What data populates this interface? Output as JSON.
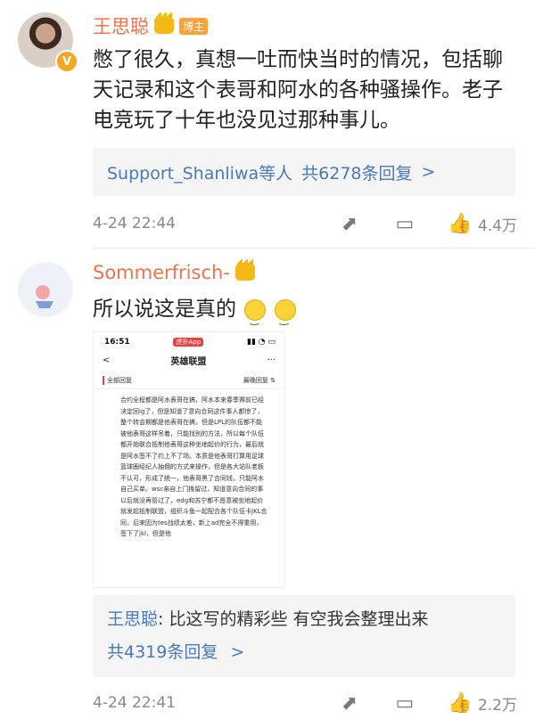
{
  "comments": [
    {
      "user": "王思聪",
      "badge": "博主",
      "verified": "V",
      "text": "憋了很久，真想一吐而快当时的情况，包括聊天记录和这个表哥和阿水的各种骚操作。老子电竞玩了十年也没见过那种事儿。",
      "replies_summary": {
        "users": "Support_Shanliwa等人",
        "count": "共6278条回复",
        "chevron": ">"
      },
      "time": "4-24 22:44",
      "likes": "4.4万"
    },
    {
      "user": "Sommerfrisch-",
      "text": "所以说这是真的",
      "embedded_screenshot": {
        "time": "16:51",
        "app": "虎扑App",
        "back": "<",
        "title": "英雄联盟",
        "more": "···",
        "filter_left": "全部回复",
        "filter_right": "最晚回复 ⇅",
        "body": "合约全程都是阿水表哥在搞，阿水本来春季赛前已经决定回ig了，但是知道了意向合同这件事人都惊了，整个转会期都是他表哥在搞，但是LPL的队伍都不能被他表哥这样吊着，只能找别的方法，所以每个队伍都开始联合抵制他表哥这种坐地起价的行为，最后就是阿水签不了约上不了场。本质是他表哥打算用足球篮球圈经纪人抽佣的方式来操作，但是各大站队老板不认可，形成了统一，他表哥黑了合同钱，只能阿水自己买单。wsc亲自上门挽留过，知道意向合同的事以后就没再管过了，edg和苏宁都不愿意被坐地起价就发起抵制联盟，组织斗鱼一起配合各个队伍卡JKL合同，后来因为tes战绩太差，新上ad完全不得重用，签下了jkl，但是他"
      },
      "reply": {
        "author": "王思聪",
        "sep": ": ",
        "text": "比这写的精彩些 有空我会整理出来",
        "count": "共4319条回复",
        "chevron": ">"
      },
      "time": "4-24 22:41",
      "likes": "2.2万"
    }
  ]
}
